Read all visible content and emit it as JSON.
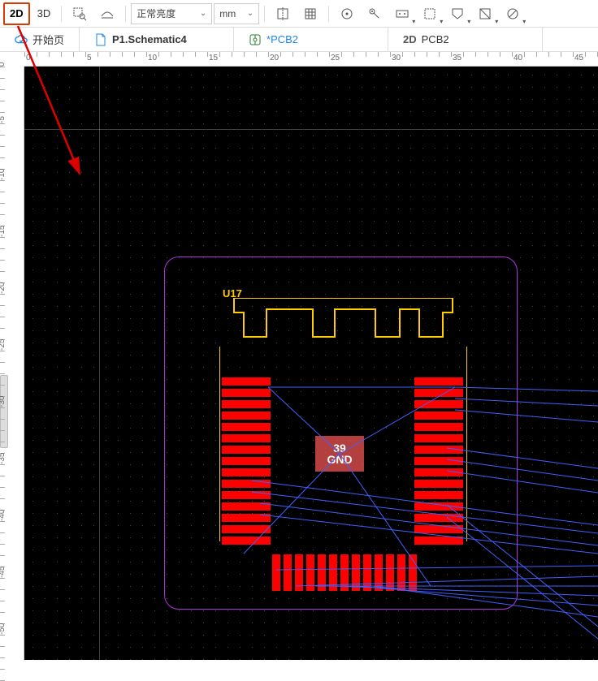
{
  "toolbar": {
    "view2d": "2D",
    "view3d": "3D",
    "brightness_label": "正常亮度",
    "units_label": "mm"
  },
  "tabs": {
    "start": "开始页",
    "schematic": "P1.Schematic4",
    "pcb_active": "*PCB2",
    "pcb2d_badge": "2D",
    "pcb2d_label": "PCB2"
  },
  "ruler_h": [
    "0",
    "5",
    "10",
    "15",
    "20",
    "25",
    "30",
    "35",
    "40",
    "45"
  ],
  "ruler_v": [
    "0",
    "-5",
    "-10",
    "-15",
    "-20",
    "-25",
    "-30",
    "-35",
    "-40",
    "-45",
    "-50"
  ],
  "component": {
    "refdes": "U17",
    "pad_number": "39",
    "pad_net": "GND"
  },
  "colors": {
    "highlight": "#d83b01",
    "silk": "#ffcc00",
    "pad": "#ff0000",
    "outline": "#b030e0",
    "ratsnest": "#4060ff"
  }
}
